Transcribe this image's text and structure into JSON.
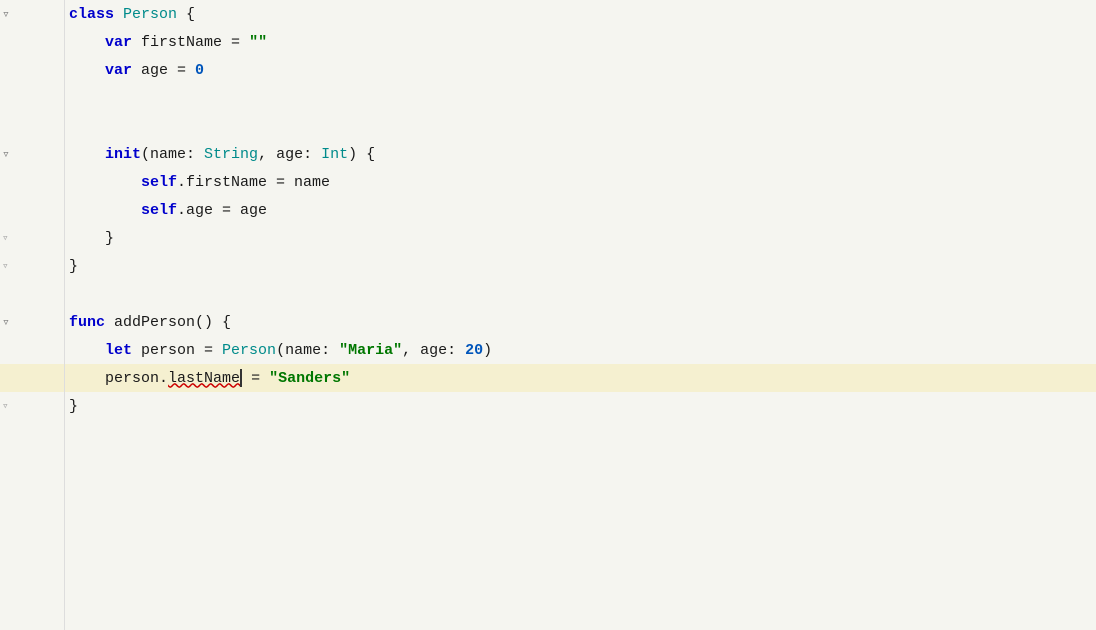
{
  "editor": {
    "background": "#f5f5f0",
    "highlight_line_bg": "#f5f0d0",
    "lines": [
      {
        "indent": 0,
        "tokens": [
          {
            "text": "class ",
            "class": "kw-class"
          },
          {
            "text": "Person",
            "class": "type-teal"
          },
          {
            "text": " {",
            "class": "plain"
          }
        ],
        "fold": "open",
        "gutter_fold": true
      },
      {
        "indent": 1,
        "tokens": [
          {
            "text": "var ",
            "class": "kw-blue"
          },
          {
            "text": "firstName = ",
            "class": "plain"
          },
          {
            "text": "\"\"",
            "class": "string-green"
          }
        ],
        "fold": false
      },
      {
        "indent": 1,
        "tokens": [
          {
            "text": "var ",
            "class": "kw-blue"
          },
          {
            "text": "age = ",
            "class": "plain"
          },
          {
            "text": "0",
            "class": "num-blue"
          }
        ],
        "fold": false
      },
      {
        "indent": 0,
        "tokens": [],
        "empty": true
      },
      {
        "indent": 0,
        "tokens": [],
        "empty": true
      },
      {
        "indent": 1,
        "tokens": [
          {
            "text": "init",
            "class": "kw-blue"
          },
          {
            "text": "(name: ",
            "class": "plain"
          },
          {
            "text": "String",
            "class": "type-teal"
          },
          {
            "text": ", age: ",
            "class": "plain"
          },
          {
            "text": "Int",
            "class": "type-teal"
          },
          {
            "text": ") {",
            "class": "plain"
          }
        ],
        "fold": "open",
        "gutter_fold": true
      },
      {
        "indent": 2,
        "tokens": [
          {
            "text": "self",
            "class": "self-blue"
          },
          {
            "text": ".firstName = name",
            "class": "plain"
          }
        ],
        "fold": false
      },
      {
        "indent": 2,
        "tokens": [
          {
            "text": "self",
            "class": "self-blue"
          },
          {
            "text": ".age = age",
            "class": "plain"
          }
        ],
        "fold": false
      },
      {
        "indent": 1,
        "tokens": [
          {
            "text": "}",
            "class": "plain"
          }
        ],
        "fold": false,
        "gutter_fold": true,
        "fold_close": true
      },
      {
        "indent": 0,
        "tokens": [
          {
            "text": "}",
            "class": "plain"
          }
        ],
        "fold": false,
        "gutter_fold": true,
        "fold_close": true
      },
      {
        "indent": 0,
        "tokens": [],
        "empty": true
      },
      {
        "indent": 0,
        "tokens": [
          {
            "text": "func ",
            "class": "kw-blue"
          },
          {
            "text": "addPerson",
            "class": "plain"
          },
          {
            "text": "() {",
            "class": "plain"
          }
        ],
        "fold": "open",
        "gutter_fold": true
      },
      {
        "indent": 1,
        "tokens": [
          {
            "text": "let ",
            "class": "kw-blue"
          },
          {
            "text": "person = ",
            "class": "plain"
          },
          {
            "text": "Person",
            "class": "type-teal"
          },
          {
            "text": "(name: ",
            "class": "plain"
          },
          {
            "text": "\"Maria\"",
            "class": "string-green"
          },
          {
            "text": ", age: ",
            "class": "plain"
          },
          {
            "text": "20",
            "class": "num-blue"
          },
          {
            "text": ")",
            "class": "plain"
          }
        ],
        "fold": false
      },
      {
        "indent": 1,
        "tokens": [
          {
            "text": "person",
            "class": "plain"
          },
          {
            "text": ".",
            "class": "plain"
          },
          {
            "text": "lastName",
            "class": "error-underline plain"
          },
          {
            "text": " = ",
            "class": "plain"
          },
          {
            "text": "\"Sanders\"",
            "class": "string-green"
          }
        ],
        "fold": false,
        "highlighted": true,
        "cursor_after": "lastName"
      },
      {
        "indent": 0,
        "tokens": [
          {
            "text": "}",
            "class": "plain"
          }
        ],
        "fold": false,
        "gutter_fold": true,
        "fold_close": true
      }
    ]
  }
}
